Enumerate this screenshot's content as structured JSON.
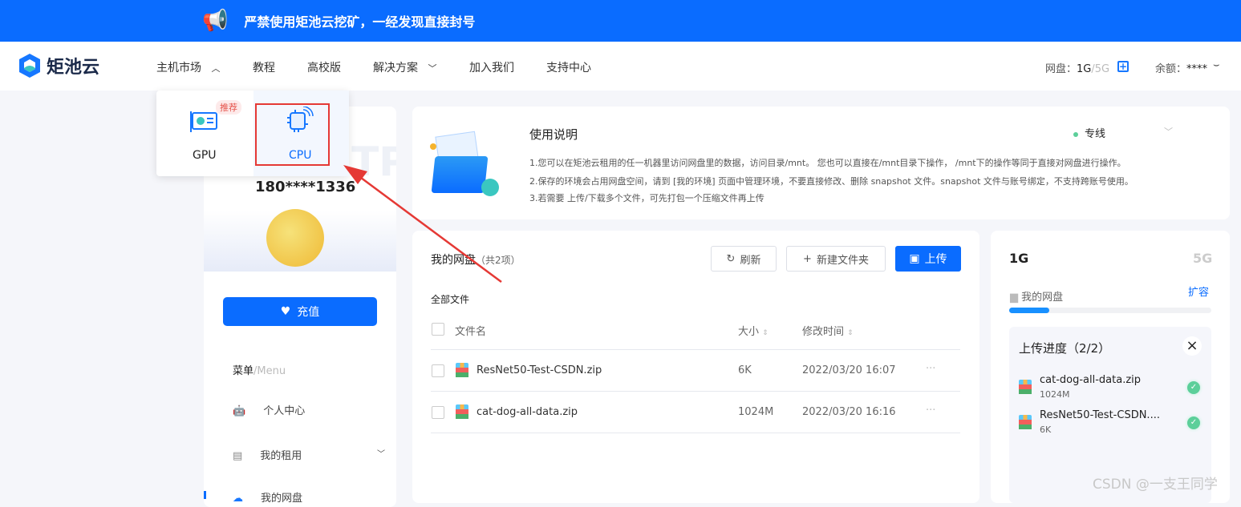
{
  "banner": {
    "text": "严禁使用矩池云挖矿，一经发现直接封号",
    "icon": "megaphone-icon"
  },
  "nav": {
    "logo": "矩池云",
    "items": [
      "主机市场",
      "教程",
      "高校版",
      "解决方案",
      "加入我们",
      "支持中心"
    ],
    "disk_label": "网盘：",
    "disk_used": "1G",
    "disk_total": "/5G",
    "balance_label": "余额：",
    "balance_value": "****"
  },
  "dropdown": {
    "items": [
      {
        "label": "GPU",
        "badge": "推荐"
      },
      {
        "label": "CPU"
      }
    ]
  },
  "profile": {
    "watermark": "FTP",
    "phone": "180****1336",
    "recharge": "充值",
    "menu_title": "菜单",
    "menu_sub": "/Menu",
    "menu": [
      {
        "label": "个人中心",
        "icon": "robot-icon"
      },
      {
        "label": "我的租用",
        "icon": "rental-icon"
      },
      {
        "label": "我的网盘",
        "icon": "cloud-icon"
      }
    ]
  },
  "info": {
    "title": "使用说明",
    "line_select": "专线",
    "line_color": "#5ccf9a",
    "lines": [
      "1.您可以在矩池云租用的任一机器里访问网盘里的数据，访问目录/mnt。 您也可以直接在/mnt目录下操作， /mnt下的操作等同于直接对网盘进行操作。",
      "2.保存的环境会占用网盘空间，请到 [我的环境] 页面中管理环境，不要直接修改、删除 snapshot 文件。snapshot 文件与账号绑定，不支持跨账号使用。",
      "3.若需要 上传/下载多个文件，可先打包一个压缩文件再上传"
    ]
  },
  "files": {
    "title": "我的网盘",
    "count": "（共2项）",
    "refresh": "刷新",
    "new_folder": "新建文件夹",
    "upload": "上传",
    "breadcrumb": "全部文件",
    "columns": [
      "文件名",
      "大小",
      "修改时间"
    ],
    "rows": [
      {
        "name": "ResNet50-Test-CSDN.zip",
        "size": "6K",
        "time": "2022/03/20 16:07"
      },
      {
        "name": "cat-dog-all-data.zip",
        "size": "1024M",
        "time": "2022/03/20 16:16"
      }
    ],
    "more": "···"
  },
  "storage": {
    "used": "1G",
    "total": "5G",
    "label": "我的网盘",
    "expand": "扩容",
    "progress": 0.2,
    "upload_title": "上传进度（2/2）",
    "uploads": [
      {
        "name": "cat-dog-all-data.zip",
        "size": "1024M"
      },
      {
        "name": "ResNet50-Test-CSDN....",
        "size": "6K"
      }
    ]
  },
  "watermark": "CSDN @一支王同学",
  "colors": {
    "primary": "#0a6cff",
    "annotation": "#e53935"
  }
}
